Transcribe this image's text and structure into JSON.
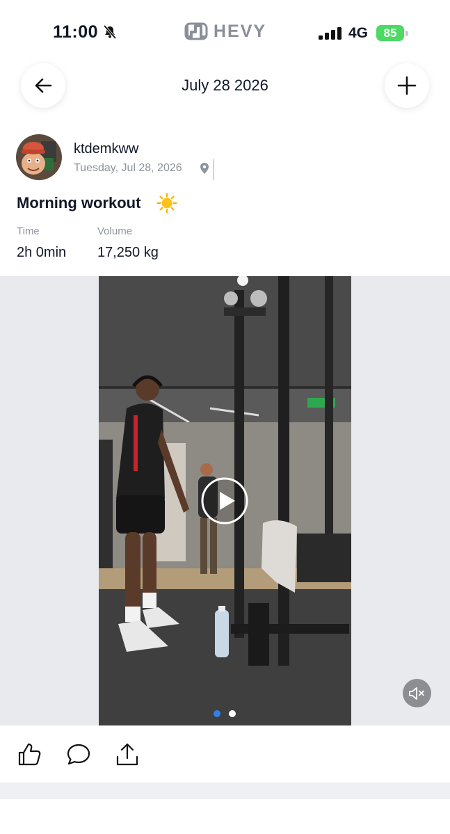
{
  "status_bar": {
    "time": "11:00",
    "network": "4G",
    "battery_percent": "85",
    "icons": [
      "bell-muted-icon",
      "signal-icon",
      "battery-icon"
    ]
  },
  "brand": {
    "name": "HEVY",
    "icon": "hevy-logo-icon"
  },
  "nav": {
    "title": "July 28 2026",
    "back_icon": "arrow-left-icon",
    "add_icon": "plus-icon"
  },
  "post": {
    "username": "ktdemkww",
    "date": "Tuesday, Jul 28, 2026",
    "location_icon": "location-pin-icon",
    "title": "Morning workout",
    "title_emoji": "sun-icon",
    "stats": [
      {
        "label": "Time",
        "value": "2h 0min"
      },
      {
        "label": "Volume",
        "value": "17,250 kg"
      }
    ]
  },
  "media": {
    "play_icon": "play-icon",
    "mute_icon": "speaker-muted-icon",
    "pages": 2,
    "active_page": 1,
    "dot_colors": {
      "active": "#2f80ed",
      "inactive": "#ffffff"
    }
  },
  "actions": {
    "icons": [
      "thumbs-up-icon",
      "comment-icon",
      "share-icon"
    ]
  },
  "colors": {
    "text": "#111827",
    "muted": "#8e939c",
    "battery": "#4cd964",
    "media_band": "#e9eaee"
  }
}
